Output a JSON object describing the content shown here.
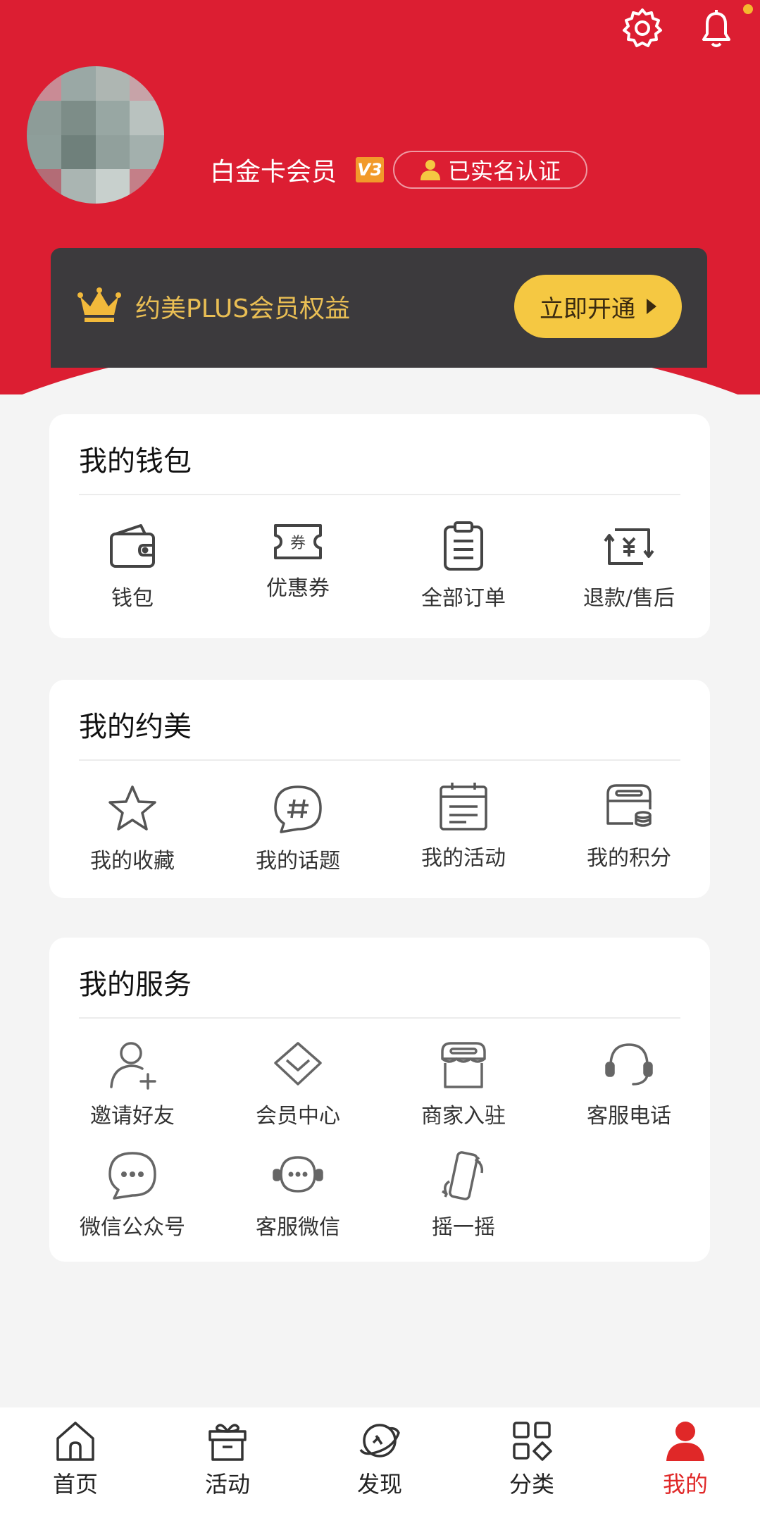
{
  "colors": {
    "brand": "#dc1e32",
    "gold": "#e9be54",
    "button": "#f5c842",
    "dark": "#3c3a3d",
    "active": "#e02828"
  },
  "header": {
    "member_level": "白金卡会员",
    "level_badge": "V3",
    "verified": "已实名认证"
  },
  "plus": {
    "title": "约美PLUS会员权益",
    "button": "立即开通"
  },
  "wallet_section": {
    "title": "我的钱包",
    "items": [
      {
        "label": "钱包",
        "icon": "wallet-icon"
      },
      {
        "label": "优惠券",
        "icon": "coupon-icon",
        "icon_text": "券"
      },
      {
        "label": "全部订单",
        "icon": "orders-icon"
      },
      {
        "label": "退款/售后",
        "icon": "refund-icon",
        "icon_text": "¥"
      }
    ]
  },
  "yuemei_section": {
    "title": "我的约美",
    "items": [
      {
        "label": "我的收藏",
        "icon": "star-icon"
      },
      {
        "label": "我的话题",
        "icon": "topic-icon"
      },
      {
        "label": "我的活动",
        "icon": "calendar-icon"
      },
      {
        "label": "我的积分",
        "icon": "points-icon"
      }
    ]
  },
  "service_section": {
    "title": "我的服务",
    "items": [
      {
        "label": "邀请好友",
        "icon": "add-user-icon"
      },
      {
        "label": "会员中心",
        "icon": "diamond-icon"
      },
      {
        "label": "商家入驻",
        "icon": "store-icon"
      },
      {
        "label": "客服电话",
        "icon": "headset-icon"
      },
      {
        "label": "微信公众号",
        "icon": "chat-icon"
      },
      {
        "label": "客服微信",
        "icon": "chat-support-icon"
      },
      {
        "label": "摇一摇",
        "icon": "shake-phone-icon"
      }
    ]
  },
  "bottom_nav": [
    {
      "label": "首页",
      "icon": "home-icon"
    },
    {
      "label": "活动",
      "icon": "gift-icon"
    },
    {
      "label": "发现",
      "icon": "discover-icon"
    },
    {
      "label": "分类",
      "icon": "category-icon"
    },
    {
      "label": "我的",
      "icon": "profile-icon",
      "active": true
    }
  ]
}
